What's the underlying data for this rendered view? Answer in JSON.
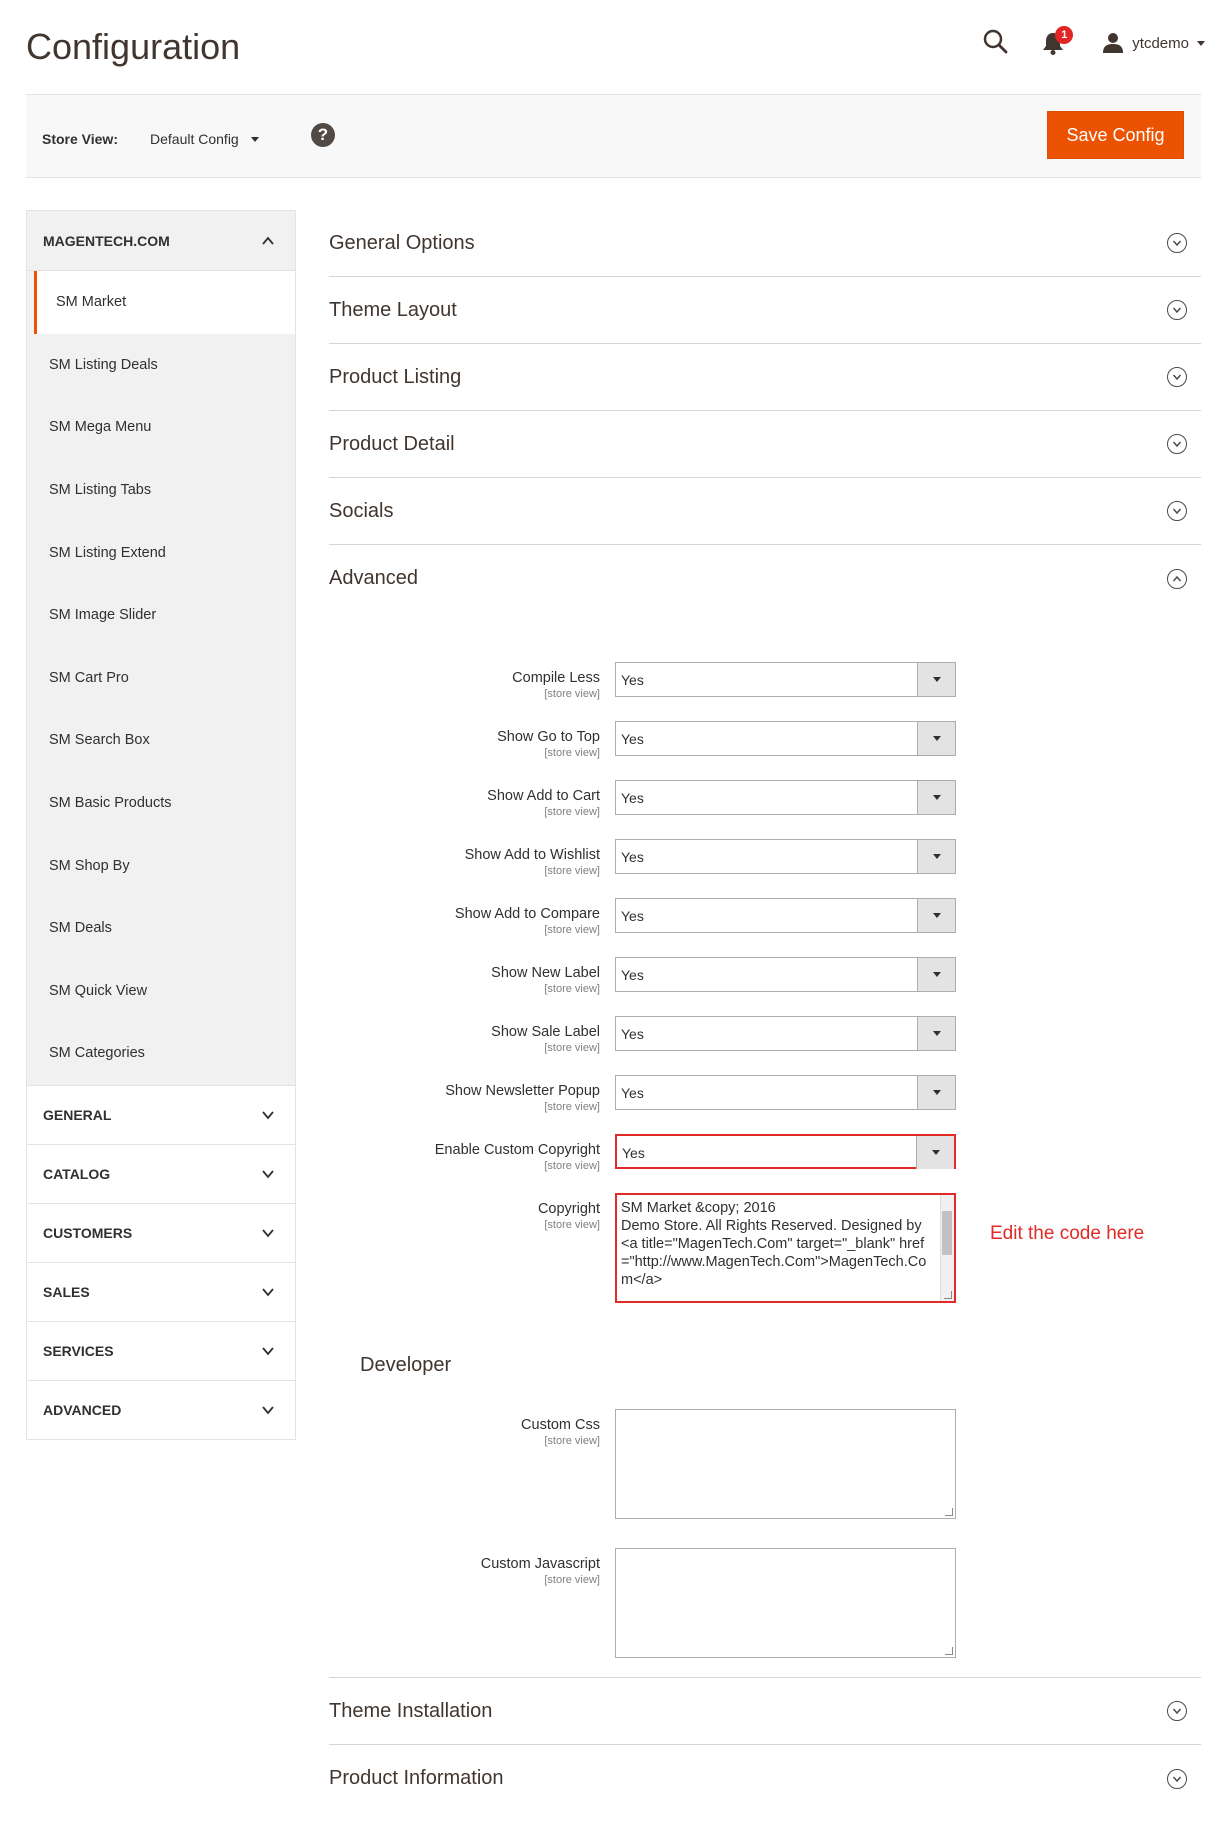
{
  "header": {
    "title": "Configuration",
    "notifications_count": "1",
    "user_name": "ytcdemo"
  },
  "store_bar": {
    "label": "Store View:",
    "selected": "Default Config",
    "help": "?",
    "save_label": "Save Config"
  },
  "sidebar": {
    "group_title": "MAGENTECH.COM",
    "items": [
      {
        "label": "SM Market"
      },
      {
        "label": "SM Listing Deals"
      },
      {
        "label": "SM Mega Menu"
      },
      {
        "label": "SM Listing Tabs"
      },
      {
        "label": "SM Listing Extend"
      },
      {
        "label": "SM Image Slider"
      },
      {
        "label": "SM Cart Pro"
      },
      {
        "label": "SM Search Box"
      },
      {
        "label": "SM Basic Products"
      },
      {
        "label": "SM Shop By"
      },
      {
        "label": "SM Deals"
      },
      {
        "label": "SM Quick View"
      },
      {
        "label": "SM Categories"
      }
    ],
    "sections": [
      {
        "label": "GENERAL"
      },
      {
        "label": "CATALOG"
      },
      {
        "label": "CUSTOMERS"
      },
      {
        "label": "SALES"
      },
      {
        "label": "SERVICES"
      },
      {
        "label": "ADVANCED"
      }
    ]
  },
  "main": {
    "sections_top": [
      {
        "label": "General Options"
      },
      {
        "label": "Theme Layout"
      },
      {
        "label": "Product Listing"
      },
      {
        "label": "Product Detail"
      },
      {
        "label": "Socials"
      }
    ],
    "advanced": {
      "title": "Advanced",
      "scope": "[store view]",
      "fields": [
        {
          "label": "Compile Less",
          "value": "Yes"
        },
        {
          "label": "Show Go to Top",
          "value": "Yes"
        },
        {
          "label": "Show Add to Cart",
          "value": "Yes"
        },
        {
          "label": "Show Add to Wishlist",
          "value": "Yes"
        },
        {
          "label": "Show Add to Compare",
          "value": "Yes"
        },
        {
          "label": "Show New Label",
          "value": "Yes"
        },
        {
          "label": "Show Sale Label",
          "value": "Yes"
        },
        {
          "label": "Show Newsletter Popup",
          "value": "Yes"
        },
        {
          "label": "Enable Custom Copyright",
          "value": "Yes"
        }
      ],
      "copyright": {
        "label": "Copyright",
        "value": "SM Market &copy; 2016\nDemo Store. All Rights Reserved. Designed by\n<a title=\"MagenTech.Com\" target=\"_blank\" href=\"http://www.MagenTech.Com\">MagenTech.Com</a>"
      },
      "annotation": "Edit the code here",
      "developer": {
        "title": "Developer",
        "css_label": "Custom Css",
        "js_label": "Custom Javascript"
      }
    },
    "sections_bottom": [
      {
        "label": "Theme Installation"
      },
      {
        "label": "Product Information"
      }
    ]
  }
}
